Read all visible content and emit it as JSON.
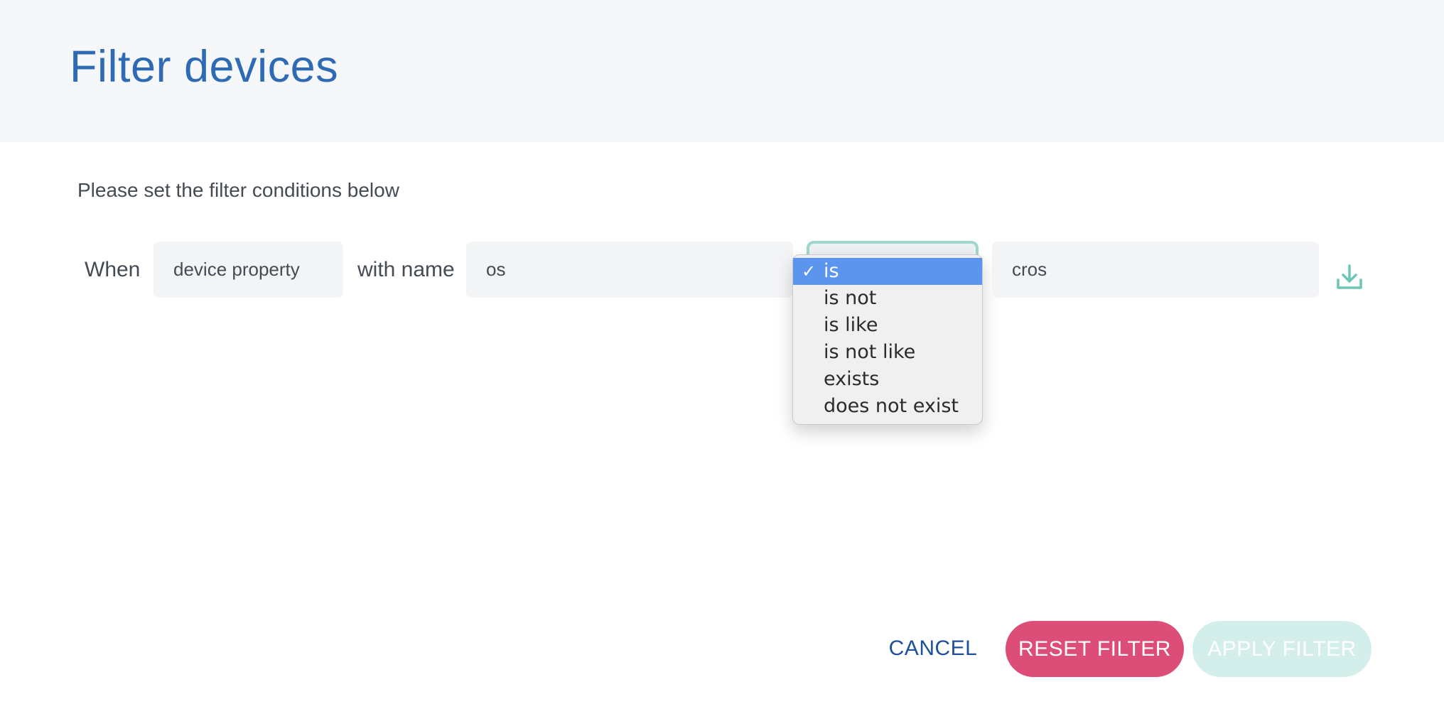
{
  "dialog": {
    "title": "Filter devices",
    "instructions": "Please set the filter conditions below"
  },
  "condition": {
    "when_label": "When",
    "property_type": "device property",
    "with_name_label": "with name",
    "name_value": "os",
    "value": "cros",
    "operator": {
      "selected": "is",
      "options": [
        "is",
        "is not",
        "is like",
        "is not like",
        "exists",
        "does not exist"
      ]
    }
  },
  "icons": {
    "save": "download-icon",
    "check": "checkmark-icon"
  },
  "footer": {
    "cancel_label": "CANCEL",
    "reset_label": "RESET FILTER",
    "apply_label": "APPLY FILTER"
  },
  "colors": {
    "title": "#2f6bb5",
    "accent_teal": "#6cc6b6",
    "reset_button": "#dc4e78",
    "apply_button_disabled": "#d4efeb",
    "selected_option": "#5b95ee"
  }
}
